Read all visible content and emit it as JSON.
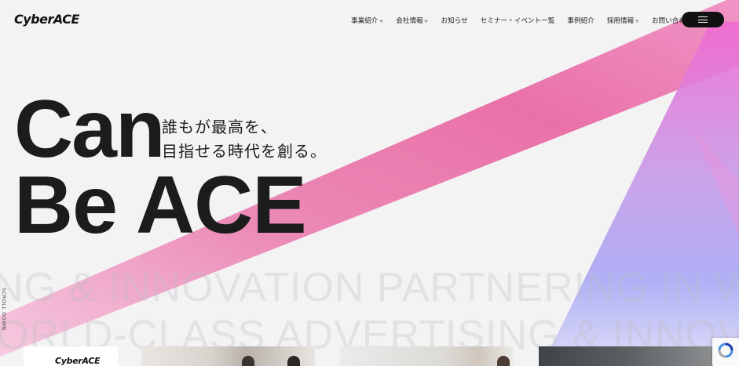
{
  "header": {
    "logo_text": "CyberACE",
    "nav": [
      {
        "label": "事業紹介",
        "has_submenu": true
      },
      {
        "label": "会社情報",
        "has_submenu": true
      },
      {
        "label": "お知らせ",
        "has_submenu": false
      },
      {
        "label": "セミナー・イベント一覧",
        "has_submenu": false
      },
      {
        "label": "事例紹介",
        "has_submenu": false
      },
      {
        "label": "採用情報",
        "has_submenu": true
      },
      {
        "label": "お問い合わせ",
        "has_submenu": false
      }
    ],
    "submenu_indicator": "+",
    "menu_icon": "hamburger-icon"
  },
  "hero": {
    "headline_line1": "Can",
    "headline_line2": "Be ACE",
    "tagline_line1": "誰もが最高を、",
    "tagline_line2": "目指せる時代を創る。",
    "marquee_line1": "NG & INNOVATION PARTNERING IN WORLD",
    "marquee_line2": "ORLD-CLASS ADVERTISING & INNOVATI",
    "scroll_label": "SCROLL DOWN"
  },
  "cards": {
    "first_logo_text": "CyberACE"
  },
  "colors": {
    "accent_pink": "#e94f9a",
    "accent_purple": "#9b8cf0",
    "menu_button": "#111111"
  }
}
